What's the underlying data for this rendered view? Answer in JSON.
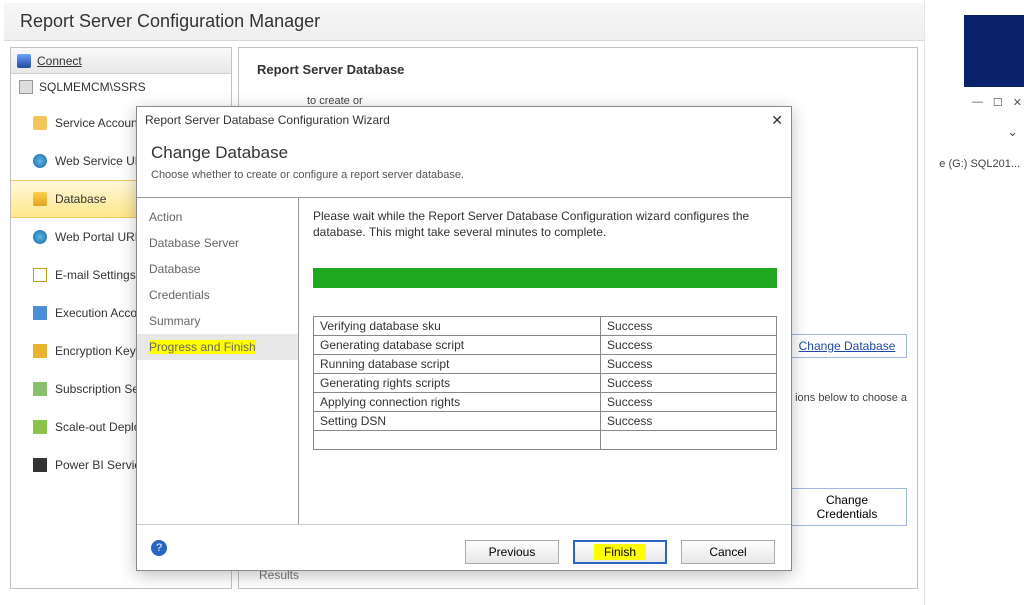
{
  "background": {
    "drive_label": "e (G:) SQL201...",
    "winbtns": {
      "min": "—",
      "max": "☐",
      "close": "✕"
    },
    "chevron": "⌄"
  },
  "main": {
    "title": "Report Server Configuration Manager",
    "connect_label": "Connect",
    "tree_root": "SQLMEMCM\\SSRS",
    "nav": [
      {
        "label": "Service Account"
      },
      {
        "label": "Web Service URL"
      },
      {
        "label": "Database"
      },
      {
        "label": "Web Portal URL"
      },
      {
        "label": "E-mail Settings"
      },
      {
        "label": "Execution Account"
      },
      {
        "label": "Encryption Keys"
      },
      {
        "label": "Subscription Settings"
      },
      {
        "label": "Scale-out Deployment"
      },
      {
        "label": "Power BI Service"
      }
    ],
    "panel": {
      "title": "Report Server Database",
      "sub": "to create or",
      "change_db_btn": "Change Database",
      "hint": "ions below to choose a",
      "change_cred_btn": "Change Credentials",
      "results_label": "Results"
    }
  },
  "wizard": {
    "title": "Report Server Database Configuration Wizard",
    "heading": "Change Database",
    "subheading": "Choose whether to create or configure a report server database.",
    "steps": [
      "Action",
      "Database Server",
      "Database",
      "Credentials",
      "Summary",
      "Progress and Finish"
    ],
    "active_step_index": 5,
    "message": "Please wait while the Report Server Database Configuration wizard configures the database.  This might take several minutes to complete.",
    "results": [
      {
        "task": "Verifying database sku",
        "status": "Success"
      },
      {
        "task": "Generating database script",
        "status": "Success"
      },
      {
        "task": "Running database script",
        "status": "Success"
      },
      {
        "task": "Generating rights scripts",
        "status": "Success"
      },
      {
        "task": "Applying connection rights",
        "status": "Success"
      },
      {
        "task": "Setting DSN",
        "status": "Success"
      }
    ],
    "buttons": {
      "previous": "Previous",
      "finish": "Finish",
      "cancel": "Cancel"
    },
    "close_glyph": "✕",
    "help_glyph": "?"
  }
}
